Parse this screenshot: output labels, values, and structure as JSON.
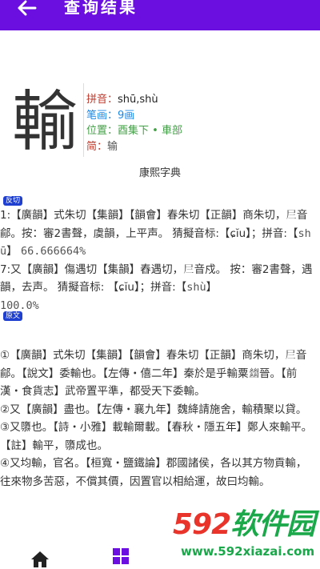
{
  "appbar": {
    "title": "查询结果",
    "back_icon": "arrow-left-icon",
    "bg_color": "#6a0fe0"
  },
  "character": {
    "glyph": "輸",
    "pinyin_label": "拼音：",
    "pinyin_value": "shū,shù",
    "bihua_label": "笔画：",
    "bihua_value": "9画",
    "weizhi_label": "位置：",
    "weizhi_value": "酉集下 • 車部",
    "jian_label": "简：",
    "jian_value": "输"
  },
  "dict_title": "康熙字典",
  "section1": {
    "badge": "反切",
    "line1": "1:【廣韻】式朱切【集韻】【韻會】春朱切【正韻】商朱切，",
    "line1b": "𡰥",
    "line1c": "音鄃。按：審2書聲，虞韻，上平声。 猜擬音标:【",
    "line1d": "ɕĭu",
    "line1e": "】；拼音:【",
    "line1f": "shū",
    "line1g": "】",
    "line1h": "66.666664%",
    "line2": "7:又【廣韻】傷遇切【集韻】舂遇切，",
    "line2b": "𡰥",
    "line2c": "音戍。 按：審2書聲，遇韻，去声。 猜擬音标: 【",
    "line2d": "ɕĭu",
    "line2e": "】；拼音:【",
    "line2f": "shù",
    "line2g": "】",
    "line2h": "100.0%"
  },
  "section2": {
    "badge": "原文",
    "p1": "①【廣韻】式朱切【集韻】【韻會】春朱切【正韻】商朱切，𡰥音鄃。【說文】委輸也。【左傳・僖二年】秦於是乎輸粟𢇍晉。【前漢・食貨志】武帝置平準，都受天下委輸。",
    "p2": "②又【廣韻】盡也。【左傳・襄九年】魏絳請施舍，輸積聚以貸。",
    "p3": "③又隳也。【詩・小雅】載輸爾載。【春秋・隱五年】鄭人來輸平。【註】輸平，隳成也。",
    "p4": "④又均輸，官名。【桓寬・鹽鐵論】郡國諸侯，各以其方物貢輸，往來物多苦惡，不償其價，因置官以相給運，故曰均輸。"
  },
  "bottom_nav": {
    "home_icon": "home-icon",
    "grid_icon": "grid-icon",
    "active_color": "#6a0fe0"
  },
  "watermark": {
    "brand_num": "592",
    "brand_text": "软件园",
    "url": "www.592xiazai.com"
  }
}
